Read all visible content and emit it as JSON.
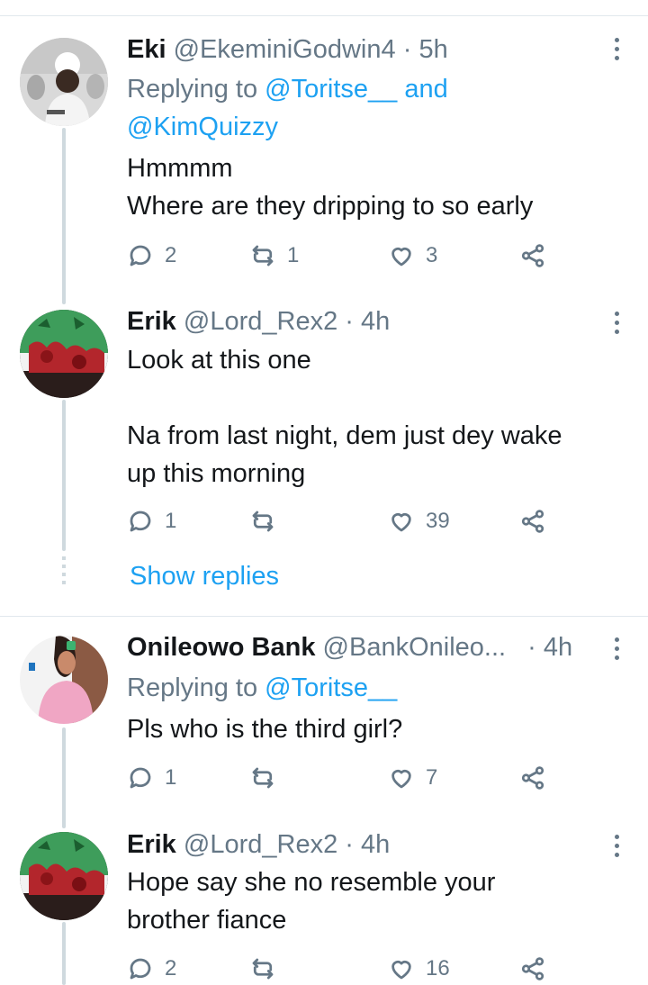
{
  "tweets": [
    {
      "name": "Eki",
      "handle": "@EkeminiGodwin4",
      "time": "5h",
      "replying_prefix": "Replying to ",
      "replying_to_1": "@Toritse__",
      "replying_joiner": " and",
      "replying_to_2": "@KimQuizzy",
      "text_lines": [
        "Hmmmm",
        "Where are they dripping to so early"
      ],
      "replies": "2",
      "retweets": "1",
      "likes": "3"
    },
    {
      "name": "Erik",
      "handle": "@Lord_Rex2",
      "time": "4h",
      "text_lines": [
        "Look at this one",
        "",
        "Na from last night, dem just dey wake",
        "up this morning"
      ],
      "replies": "1",
      "retweets": "",
      "likes": "39",
      "show_replies": "Show replies"
    },
    {
      "name": "Onileowo Bank",
      "handle": "@BankOnileo...",
      "time": "4h",
      "replying_prefix": "Replying to ",
      "replying_to_1": "@Toritse__",
      "text_lines": [
        "Pls who is the third girl?"
      ],
      "replies": "1",
      "retweets": "",
      "likes": "7"
    },
    {
      "name": "Erik",
      "handle": "@Lord_Rex2",
      "time": "4h",
      "text_lines": [
        "Hope say she  no resemble your",
        "brother fiance"
      ],
      "replies": "2",
      "retweets": "",
      "likes": "16"
    }
  ],
  "dot_separator": "·",
  "colors": {
    "link": "#1da1f2",
    "secondary": "#657786",
    "line": "#cfd9de"
  },
  "icons": [
    "reply-icon",
    "retweet-icon",
    "like-icon",
    "share-icon",
    "more-icon"
  ]
}
